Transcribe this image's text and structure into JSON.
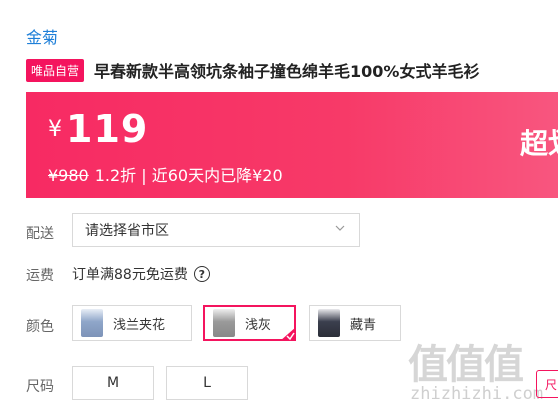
{
  "brand": "金菊",
  "product": {
    "badge": "唯品自营",
    "title": "早春新款半高领坑条袖子撞色绵羊毛100%女式羊毛衫"
  },
  "price": {
    "currency": "¥",
    "amount": "119",
    "original": "¥980",
    "discount": "1.2折",
    "separator": "|",
    "drop_note": "近60天内已降¥20",
    "promo_partial": "超划"
  },
  "delivery": {
    "label": "配送",
    "placeholder": "请选择省市区"
  },
  "shipping": {
    "label": "运费",
    "text": "订单满88元免运费",
    "help_icon": "?"
  },
  "colors": {
    "label": "颜色",
    "options": [
      {
        "name": "浅兰夹花",
        "selected": false,
        "swatch": "#8fa6c9"
      },
      {
        "name": "浅灰",
        "selected": true,
        "swatch": "#9a9a9a"
      },
      {
        "name": "藏青",
        "selected": false,
        "swatch": "#3b3f4e"
      }
    ]
  },
  "sizes": {
    "label": "尺码",
    "options": [
      "M",
      "L"
    ]
  },
  "size_chart_partial": "尺",
  "watermark": {
    "glyphs": "值值值",
    "domain": "zhizhizhi.com"
  },
  "accent_color": "#f4145e"
}
